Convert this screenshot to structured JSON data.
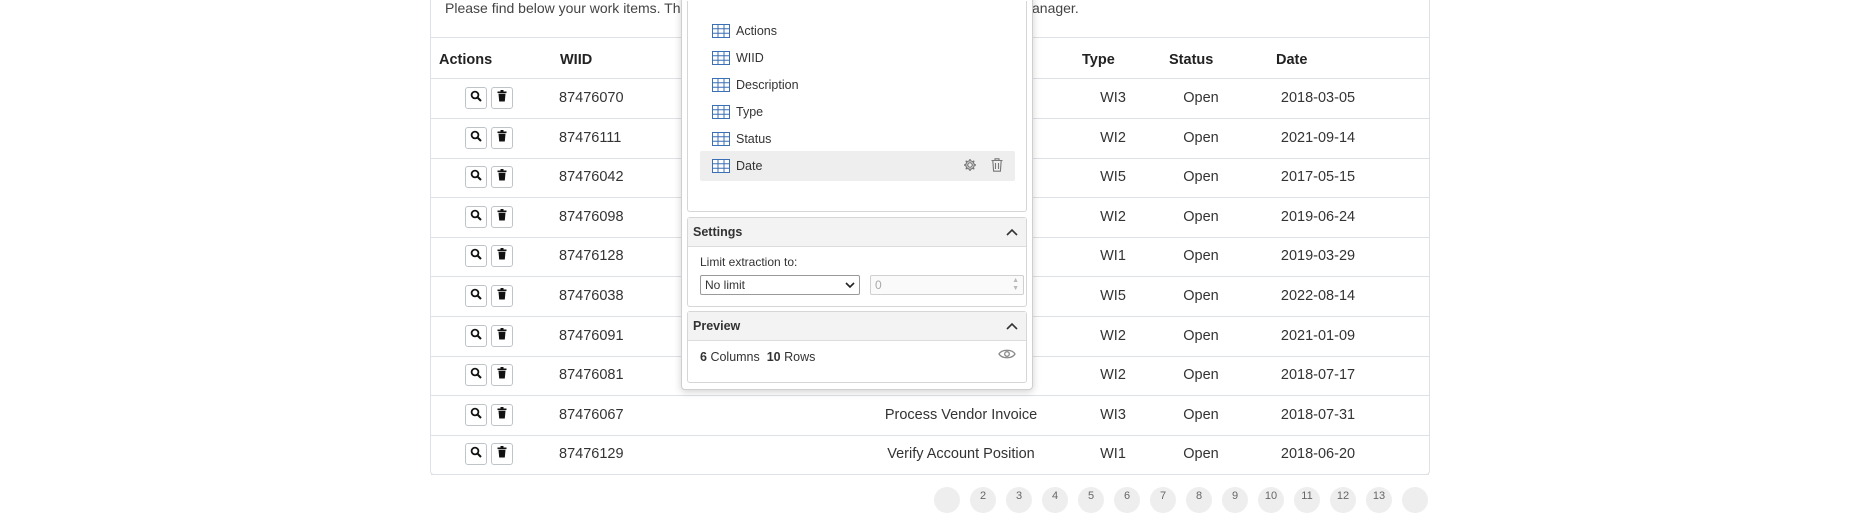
{
  "intro": {
    "left": "Please find below your work items. The",
    "right": "anager."
  },
  "table": {
    "headers": {
      "actions": "Actions",
      "wiid": "WIID",
      "type": "Type",
      "status": "Status",
      "date": "Date"
    },
    "rows": [
      {
        "wiid": "87476070",
        "description": "",
        "type": "WI3",
        "status": "Open",
        "date": "2018-03-05"
      },
      {
        "wiid": "87476111",
        "description": "",
        "type": "WI2",
        "status": "Open",
        "date": "2021-09-14"
      },
      {
        "wiid": "87476042",
        "description": "",
        "type": "WI5",
        "status": "Open",
        "date": "2017-05-15"
      },
      {
        "wiid": "87476098",
        "description": "",
        "type": "WI2",
        "status": "Open",
        "date": "2019-06-24"
      },
      {
        "wiid": "87476128",
        "description": "",
        "type": "WI1",
        "status": "Open",
        "date": "2019-03-29"
      },
      {
        "wiid": "87476038",
        "description": "",
        "type": "WI5",
        "status": "Open",
        "date": "2022-08-14"
      },
      {
        "wiid": "87476091",
        "description": "",
        "type": "WI2",
        "status": "Open",
        "date": "2021-01-09"
      },
      {
        "wiid": "87476081",
        "description": "",
        "type": "WI2",
        "status": "Open",
        "date": "2018-07-17"
      },
      {
        "wiid": "87476067",
        "description": "Process Vendor Invoice",
        "type": "WI3",
        "status": "Open",
        "date": "2018-07-31"
      },
      {
        "wiid": "87476129",
        "description": "Verify Account Position",
        "type": "WI1",
        "status": "Open",
        "date": "2018-06-20"
      }
    ],
    "action_icons": [
      "search-icon",
      "trash-icon"
    ]
  },
  "pagination": {
    "pages": [
      "",
      "2",
      "3",
      "4",
      "5",
      "6",
      "7",
      "8",
      "9",
      "10",
      "11",
      "12",
      "13",
      ""
    ]
  },
  "panel": {
    "columns": [
      {
        "label": "Actions"
      },
      {
        "label": "WIID"
      },
      {
        "label": "Description"
      },
      {
        "label": "Type"
      },
      {
        "label": "Status"
      },
      {
        "label": "Date"
      }
    ],
    "selected_column": "Date",
    "settings": {
      "title": "Settings",
      "limit_label": "Limit extraction to:",
      "limit_value": "No limit",
      "limit_number": "0"
    },
    "preview": {
      "title": "Preview",
      "columns_count": "6",
      "columns_label": "Columns",
      "rows_count": "10",
      "rows_label": "Rows"
    }
  },
  "colors": {
    "border": "#dee2e6",
    "selected_bg": "#eeeeee",
    "icon_blue": "#3b6fb6"
  }
}
